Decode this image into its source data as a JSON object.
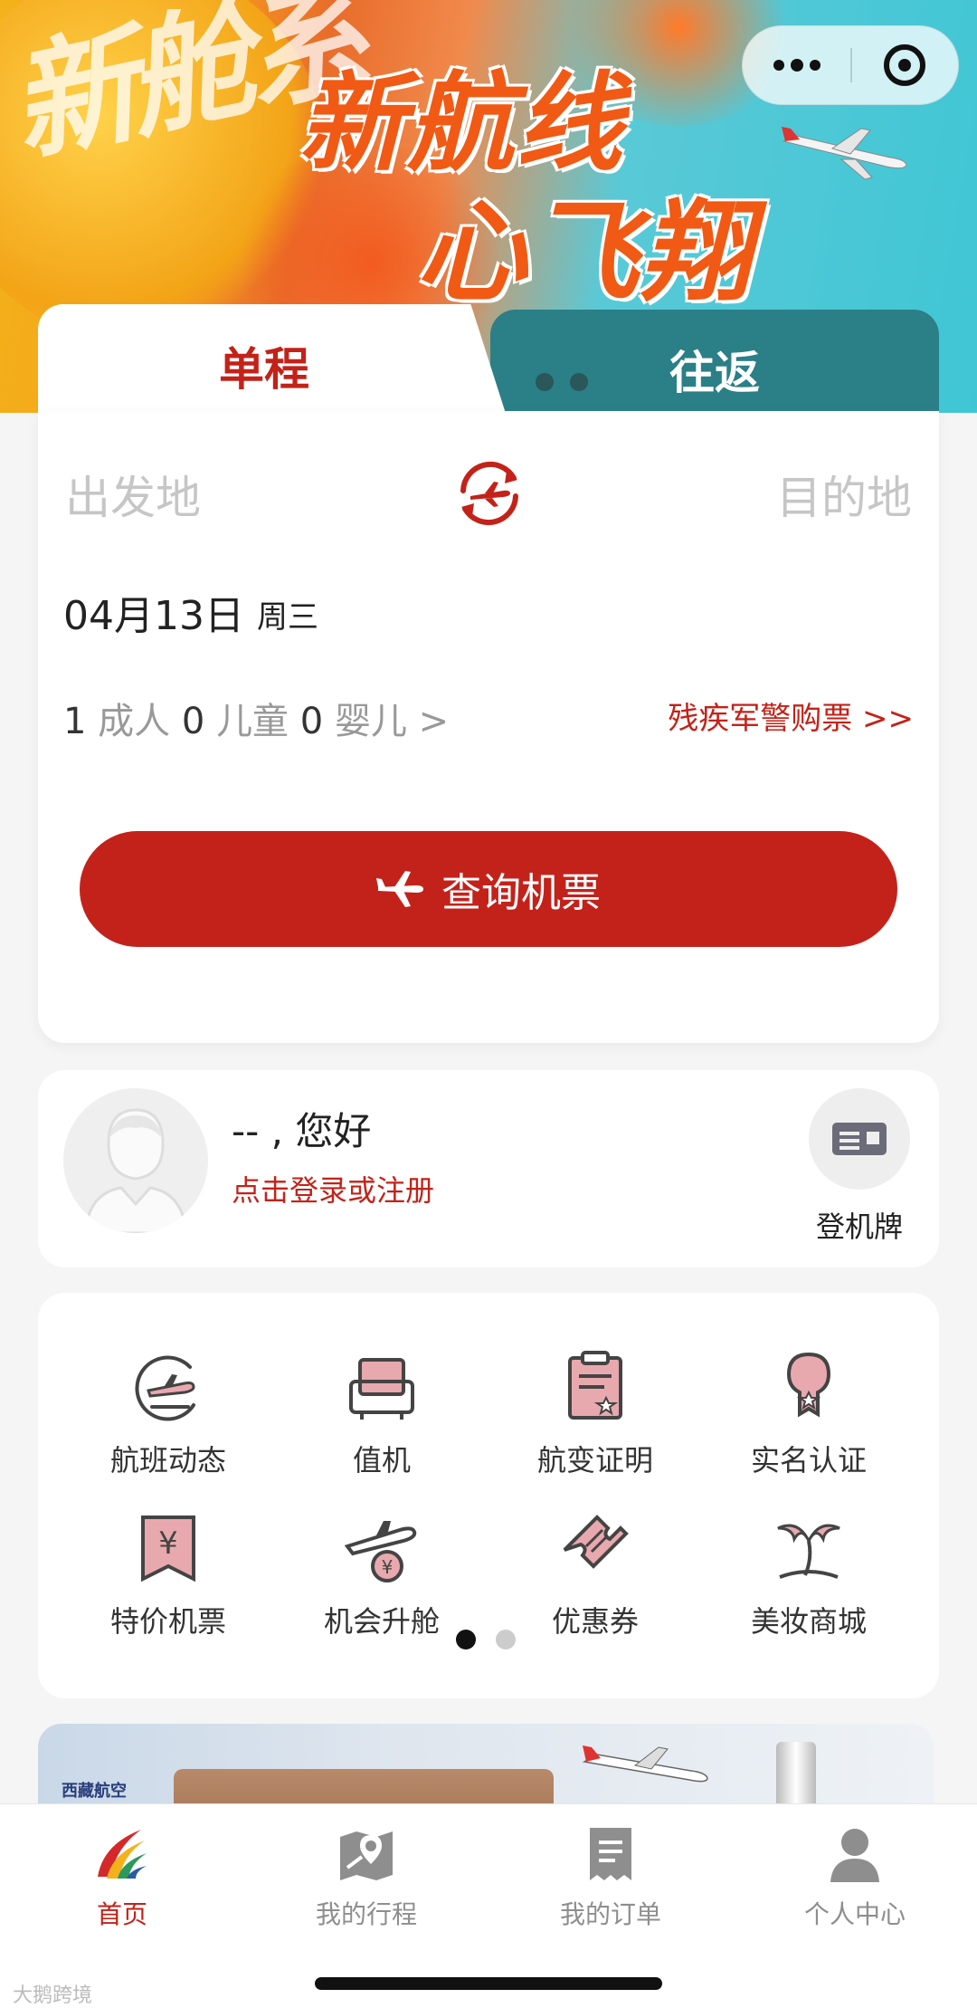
{
  "hero": {
    "calligraphy": "新舱系",
    "title_line1": "新航线",
    "title_line2": "心飞翔"
  },
  "capsule": {
    "more_icon": "more-dots-icon",
    "close_icon": "target-icon"
  },
  "booking": {
    "tabs": [
      {
        "label": "单程",
        "active": true
      },
      {
        "label": "往返",
        "active": false
      }
    ],
    "origin_placeholder": "出发地",
    "destination_placeholder": "目的地",
    "date": "04月13日",
    "weekday": "周三",
    "passengers": {
      "adult_count": "1",
      "adult_label": "成人",
      "child_count": "0",
      "child_label": "儿童",
      "infant_count": "0",
      "infant_label": "婴儿",
      "arrow": ">"
    },
    "special_link": "残疾军警购票 >>",
    "search_label": "查询机票"
  },
  "user": {
    "greeting": "-- , 您好",
    "login_prompt": "点击登录或注册",
    "boarding_pass_label": "登机牌"
  },
  "services": {
    "items": [
      {
        "label": "航班动态",
        "icon": "flight-status-icon"
      },
      {
        "label": "值机",
        "icon": "checkin-seat-icon"
      },
      {
        "label": "航变证明",
        "icon": "certificate-icon"
      },
      {
        "label": "实名认证",
        "icon": "verification-icon"
      },
      {
        "label": "特价机票",
        "icon": "special-ticket-icon"
      },
      {
        "label": "机会升舱",
        "icon": "upgrade-icon"
      },
      {
        "label": "优惠券",
        "icon": "coupon-icon"
      },
      {
        "label": "美妆商城",
        "icon": "beauty-mall-icon"
      }
    ],
    "page_count": 2,
    "current_page": 1
  },
  "promo": {
    "brand": "西藏航空"
  },
  "tabbar": {
    "items": [
      {
        "label": "首页",
        "active": true
      },
      {
        "label": "我的行程",
        "active": false
      },
      {
        "label": "我的订单",
        "active": false
      },
      {
        "label": "个人中心",
        "active": false
      }
    ]
  },
  "watermark": "大鹅跨境",
  "colors": {
    "brand_red": "#c3221b",
    "teal": "#2b7f87",
    "placeholder": "#c6c6c6"
  }
}
